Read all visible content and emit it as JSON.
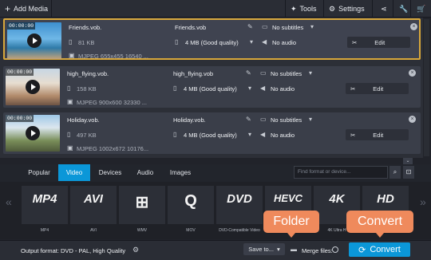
{
  "toolbar": {
    "add_media": "Add Media",
    "tools": "Tools",
    "settings": "Settings"
  },
  "files": [
    {
      "time": "00:00:00",
      "src_name": "Friends.vob.",
      "size": "81 KB",
      "codec": "MJPEG 655x455 16540 ...",
      "out_name": "Friends.vob",
      "out_size": "4 MB (Good quality)",
      "subtitles": "No subtitles",
      "audio": "No audio",
      "edit": "Edit"
    },
    {
      "time": "00:00:00",
      "src_name": "high_flying.vob.",
      "size": "158 KB",
      "codec": "MJPEG 900x600 32330 ...",
      "out_name": "high_flying.vob",
      "out_size": "4 MB (Good quality)",
      "subtitles": "No subtitles",
      "audio": "No audio",
      "edit": "Edit"
    },
    {
      "time": "00:00:00",
      "src_name": "Holiday.vob.",
      "size": "497 KB",
      "codec": "MJPEG 1002x672 10176...",
      "out_name": "Holiday.vob.",
      "out_size": "4 MB (Good quality)",
      "subtitles": "No subtitles",
      "audio": "No audio",
      "edit": "Edit"
    }
  ],
  "tabs": [
    "Popular",
    "Video",
    "Devices",
    "Audio",
    "Images"
  ],
  "active_tab": "Video",
  "search_placeholder": "Find format or device...",
  "formats": [
    {
      "logo": "MP4",
      "label": "MP4"
    },
    {
      "logo": "AVI",
      "label": "AVI"
    },
    {
      "logo": "⊞",
      "label": "WMV"
    },
    {
      "logo": "Q",
      "label": "MOV"
    },
    {
      "logo": "DVD",
      "label": "DVD-Compatible Video"
    },
    {
      "logo": "HEVC",
      "label": ""
    },
    {
      "logo": "4K",
      "label": "4K Ultra H"
    },
    {
      "logo": "HD",
      "label": ""
    }
  ],
  "bottom": {
    "output_format": "Output format: DVD - PAL, High Quality",
    "save_to": "Save to...",
    "merge_files": "Merge files:",
    "convert": "Convert"
  },
  "callouts": {
    "folder": "Folder",
    "convert": "Convert"
  },
  "colors": {
    "accent": "#0b97d8",
    "selected_border": "#d7a73b",
    "callout": "#ef8a5c"
  }
}
